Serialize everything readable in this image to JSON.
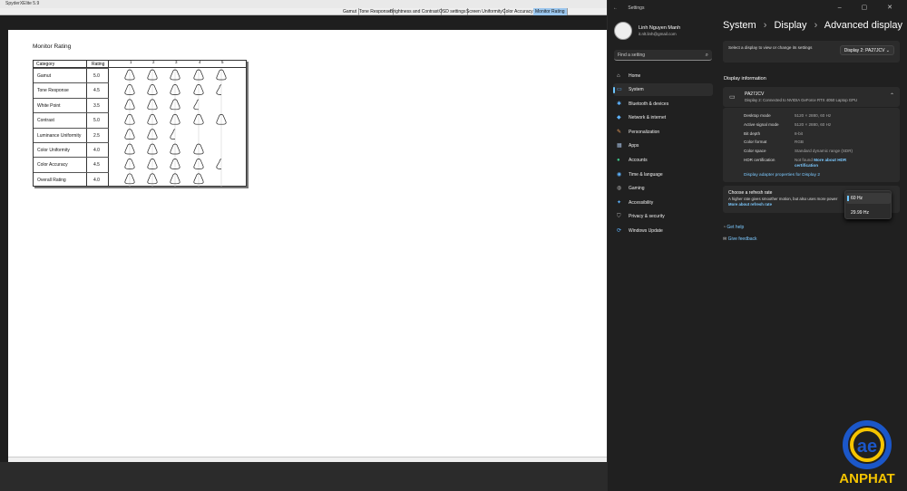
{
  "app": {
    "title": "SpyderXElite 5.9",
    "tabs": [
      "Gamut",
      "Tone Response",
      "Brightness and Contrast",
      "OSD settings",
      "Screen Uniformity",
      "Color Accuracy",
      "Monitor Rating"
    ],
    "active_tab": "Monitor Rating"
  },
  "report": {
    "title": "Monitor Rating",
    "headers": {
      "category": "Category",
      "rating": "Rating"
    },
    "col_numbers": [
      "1",
      "2",
      "3",
      "4",
      "5"
    ],
    "rows": [
      {
        "category": "Gamut",
        "rating": "5.0"
      },
      {
        "category": "Tone Response",
        "rating": "4.5"
      },
      {
        "category": "White Point",
        "rating": "3.5"
      },
      {
        "category": "Contrast",
        "rating": "5.0"
      },
      {
        "category": "Luminance Uniformity",
        "rating": "2.5"
      },
      {
        "category": "Color Uniformity",
        "rating": "4.0"
      },
      {
        "category": "Color Accuracy",
        "rating": "4.5"
      },
      {
        "category": "Overall Rating",
        "rating": "4.0"
      }
    ]
  },
  "settings": {
    "window_title": "Settings",
    "back": "←",
    "window_controls": "–  ▢  ✕",
    "user": {
      "name": "Linh Nguyen Manh",
      "email": "it.nlt.linh@gmail.com"
    },
    "search_placeholder": "Find a setting",
    "nav": [
      "Home",
      "System",
      "Bluetooth & devices",
      "Network & internet",
      "Personalization",
      "Apps",
      "Accounts",
      "Time & language",
      "Gaming",
      "Accessibility",
      "Privacy & security",
      "Windows Update"
    ],
    "nav_active": "System",
    "breadcrumb": {
      "a": "System",
      "b": "Display",
      "c": "Advanced display",
      "sep": "›"
    },
    "select_display": {
      "label": "Select a display to view or change its settings",
      "value": "Display 2: PA27JCV"
    },
    "display_info_heading": "Display information",
    "monitor": {
      "name": "PA27JCV",
      "sub": "Display 2: Connected to NVIDIA GeForce RTX 4050 Laptop GPU"
    },
    "info": [
      {
        "k": "Desktop mode",
        "v": "5120 × 2880, 60 Hz"
      },
      {
        "k": "Active signal mode",
        "v": "5120 × 2880, 60 Hz"
      },
      {
        "k": "Bit depth",
        "v": "8-bit"
      },
      {
        "k": "Color format",
        "v": "RGB"
      },
      {
        "k": "Color space",
        "v": "Standard dynamic range (SDR)"
      },
      {
        "k": "HDR certification",
        "v": "Not found",
        "link": "More about HDR certification"
      }
    ],
    "adapter_link": "Display adapter properties for Display 2",
    "refresh": {
      "title": "Choose a refresh rate",
      "desc": "A higher rate gives smoother motion, but also uses more power",
      "link": "More about refresh rate",
      "options": [
        "60 Hz",
        "29.99 Hz"
      ],
      "selected": "60 Hz"
    },
    "help": "Get help",
    "feedback": "Give feedback"
  },
  "watermark": {
    "text": "ANPHAT",
    "color": "#f5c400"
  }
}
